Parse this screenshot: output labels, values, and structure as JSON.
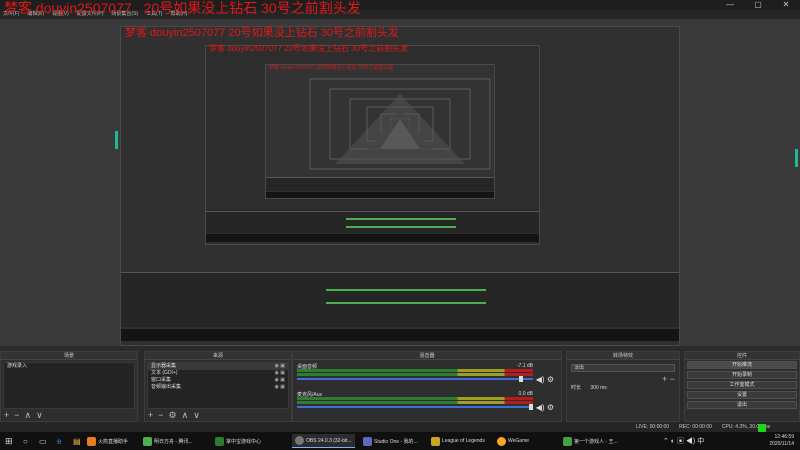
{
  "overlay": {
    "part1": "梦客 douyin2507077",
    "part2": "20号如果没上钻石  30号之前割头发"
  },
  "menu": [
    "文件(F)",
    "编辑(E)",
    "视图(V)",
    "配置文件(P)",
    "场景集合(S)",
    "工具(T)",
    "帮助(H)"
  ],
  "window_controls": [
    "—",
    "▢",
    "✕"
  ],
  "nested": {
    "level1_title": "梦客 douyin2507077    20号如果没上钻石  30号之前割头发",
    "level2_title": "梦客 douyin2507077    20号如果没上钻石  30号之前割头发",
    "level3_title": "梦客 douyin2507077    20号如果没上钻石  30号之前割头发"
  },
  "docks": {
    "scenes": {
      "title": "场景",
      "items": [
        "游戏录入"
      ]
    },
    "sources": {
      "title": "来源",
      "items": [
        "显示器采集",
        "文本 (GDI+)",
        "窗口采集",
        "音频输出采集"
      ]
    },
    "mixer": {
      "title": "混音器",
      "channels": [
        {
          "name": "桌面音频",
          "db": "-7.1 dB"
        },
        {
          "name": "麦克风/Aux",
          "db": "0.0 dB"
        }
      ]
    },
    "transitions": {
      "title": "转场特效",
      "selected": "淡出",
      "duration_label": "时长",
      "duration_value": "300 ms"
    },
    "controls": {
      "title": "控件",
      "buttons": [
        "开始推流",
        "开始录制",
        "工作室模式",
        "设置",
        "退出"
      ]
    }
  },
  "footer_icons": {
    "add": "+",
    "remove": "−",
    "up": "∧",
    "down": "∨",
    "settings": "⚙"
  },
  "status": {
    "live": "LIVE: 00:00:00",
    "rec": "REC: 00:00:00",
    "cpu": "CPU: 4.3%, 30.00 fps"
  },
  "taskbar": {
    "apps": [
      {
        "label": "火箭直播助手",
        "color": "#e67e22",
        "active": false
      },
      {
        "label": "明日方舟 - 腾讯...",
        "color": "#4caf50",
        "active": false
      },
      {
        "label": "掌中宝游戏中心",
        "color": "#2e7d32",
        "active": false
      },
      {
        "label": "OBS 24.0.3 (32-bit...",
        "color": "#777777",
        "active": true
      },
      {
        "label": "Studio One - 我的...",
        "color": "#5c6bc0",
        "active": false
      },
      {
        "label": "League of Legends",
        "color": "#c9a227",
        "active": false
      },
      {
        "label": "WeGame",
        "color": "#f9a825",
        "active": false
      },
      {
        "label": "第一个游戏人 - 王...",
        "color": "#43a047",
        "active": false
      }
    ],
    "clock_time": "12:46:59",
    "clock_date": "2020/11/14"
  }
}
